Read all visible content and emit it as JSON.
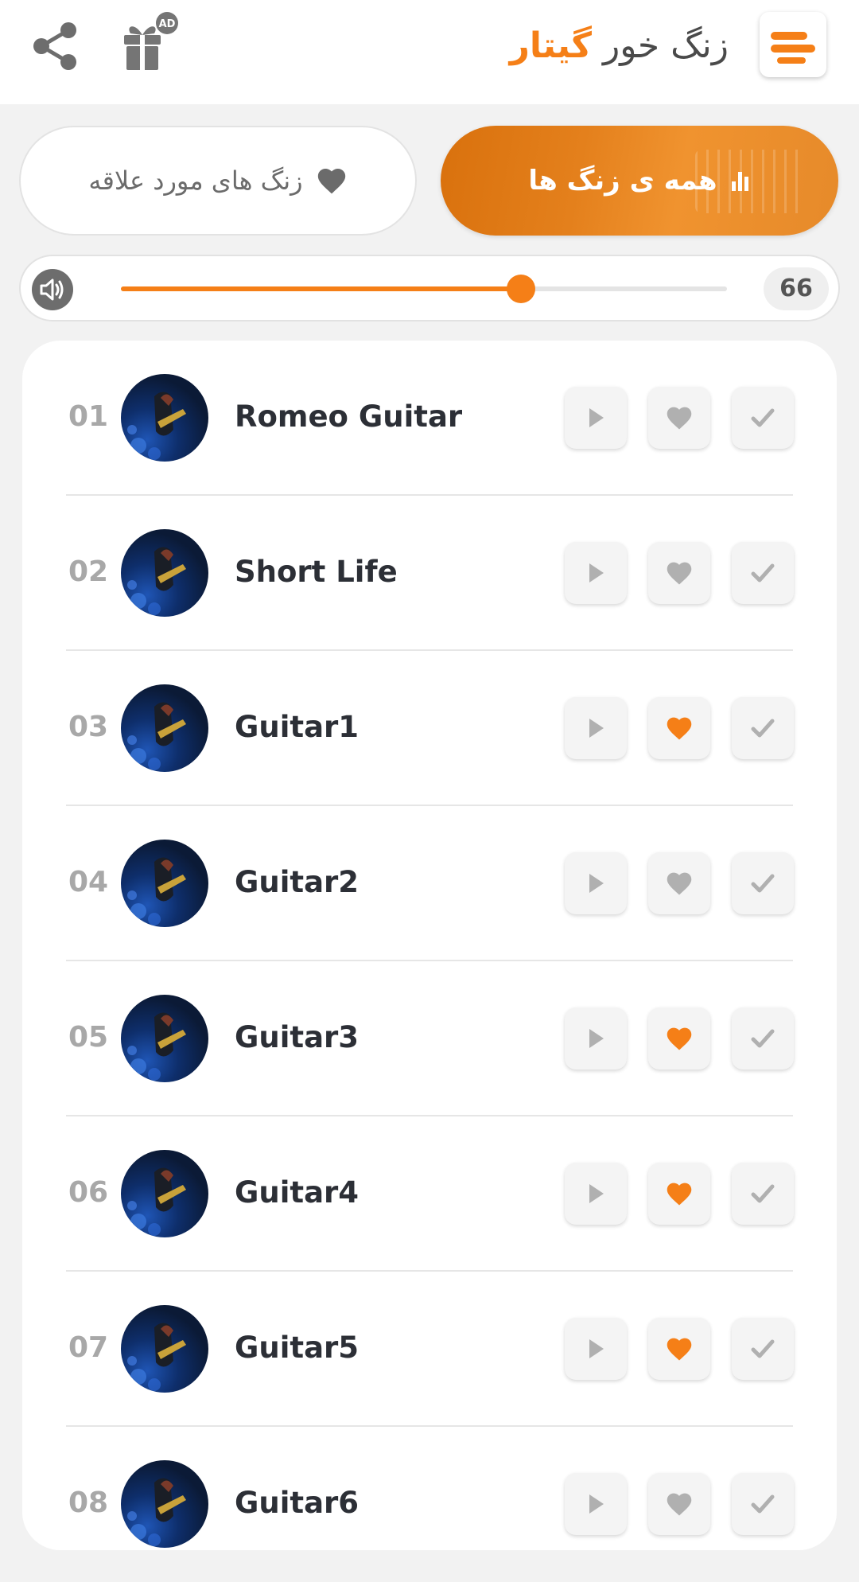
{
  "colors": {
    "accent": "#f57f17",
    "icon_gray": "#6d6d6d",
    "inactive_icon": "#b0b0b0"
  },
  "header": {
    "title_prefix": "زنگ خور",
    "title_accent": "گیتار",
    "ad_badge": "AD",
    "icons": {
      "menu": "menu-icon",
      "gift": "gift-icon",
      "share": "share-icon"
    }
  },
  "tabs": {
    "all": {
      "label": "همه ی زنگ ها",
      "icon": "equalizer-icon",
      "active": true
    },
    "favorites": {
      "label": "زنگ های مورد علاقه",
      "icon": "heart-icon",
      "active": false
    }
  },
  "volume": {
    "value": "66",
    "level": 0.66,
    "icon": "speaker-icon"
  },
  "tracks": [
    {
      "number": "01",
      "title": "Romeo Guitar",
      "favorite": false
    },
    {
      "number": "02",
      "title": "Short Life",
      "favorite": false
    },
    {
      "number": "03",
      "title": "Guitar1",
      "favorite": true
    },
    {
      "number": "04",
      "title": "Guitar2",
      "favorite": false
    },
    {
      "number": "05",
      "title": "Guitar3",
      "favorite": true
    },
    {
      "number": "06",
      "title": "Guitar4",
      "favorite": true
    },
    {
      "number": "07",
      "title": "Guitar5",
      "favorite": true
    },
    {
      "number": "08",
      "title": "Guitar6",
      "favorite": false
    }
  ]
}
